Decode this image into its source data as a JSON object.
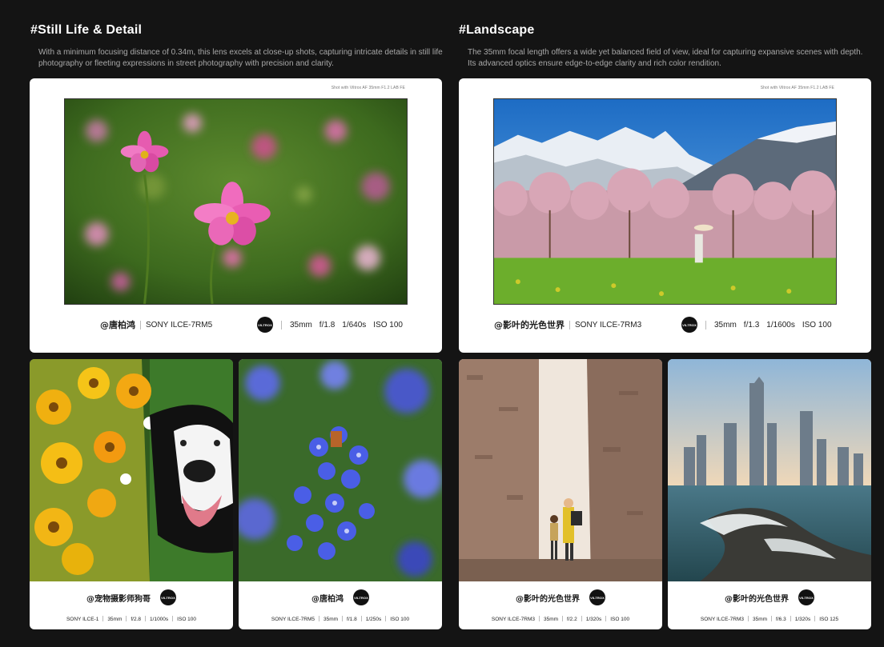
{
  "left": {
    "title": "#Still Life & Detail",
    "description": "With a minimum focusing distance of 0.34m, this lens excels at close-up shots, capturing intricate details in still life photography or fleeting expressions in street photography with precision and clarity.",
    "featured": {
      "shot_with": "Shot with Viltrox AF 35mm F1.2 LAB FE",
      "author": "@唐柏鸿",
      "camera": "SONY ILCE-7RM5",
      "logo_text": "VILTROX",
      "focal": "35mm",
      "aperture": "f/1.8",
      "shutter": "1/640s",
      "iso": "ISO 100"
    },
    "cards": [
      {
        "author": "@宠物摄影师狗哥",
        "logo_text": "VILTROX",
        "camera": "SONY ILCE-1",
        "focal": "35mm",
        "aperture": "f/2.8",
        "shutter": "1/1000s",
        "iso": "ISO 100"
      },
      {
        "author": "@唐柏鸿",
        "logo_text": "VILTROX",
        "camera": "SONY ILCE-7RM5",
        "focal": "35mm",
        "aperture": "f/1.8",
        "shutter": "1/250s",
        "iso": "ISO 100"
      }
    ]
  },
  "right": {
    "title": "#Landscape",
    "description": "The 35mm focal length offers a wide yet balanced field of view, ideal for capturing expansive scenes with depth. Its advanced optics ensure edge-to-edge clarity and rich color rendition.",
    "featured": {
      "shot_with": "Shot with Viltrox AF 35mm F1.2 LAB FE",
      "author": "@影叶的光色世界",
      "camera": "SONY ILCE-7RM3",
      "logo_text": "VILTROX",
      "focal": "35mm",
      "aperture": "f/1.3",
      "shutter": "1/1600s",
      "iso": "ISO 100"
    },
    "cards": [
      {
        "author": "@影叶的光色世界",
        "logo_text": "VILTROX",
        "camera": "SONY ILCE-7RM3",
        "focal": "35mm",
        "aperture": "f/2.2",
        "shutter": "1/320s",
        "iso": "ISO 100"
      },
      {
        "author": "@影叶的光色世界",
        "logo_text": "VILTROX",
        "camera": "SONY ILCE-7RM3",
        "focal": "35mm",
        "aperture": "f/6.3",
        "shutter": "1/320s",
        "iso": "ISO 125"
      }
    ]
  },
  "colors": {
    "background": "#141414",
    "card": "#ffffff",
    "logo": "#111111"
  }
}
